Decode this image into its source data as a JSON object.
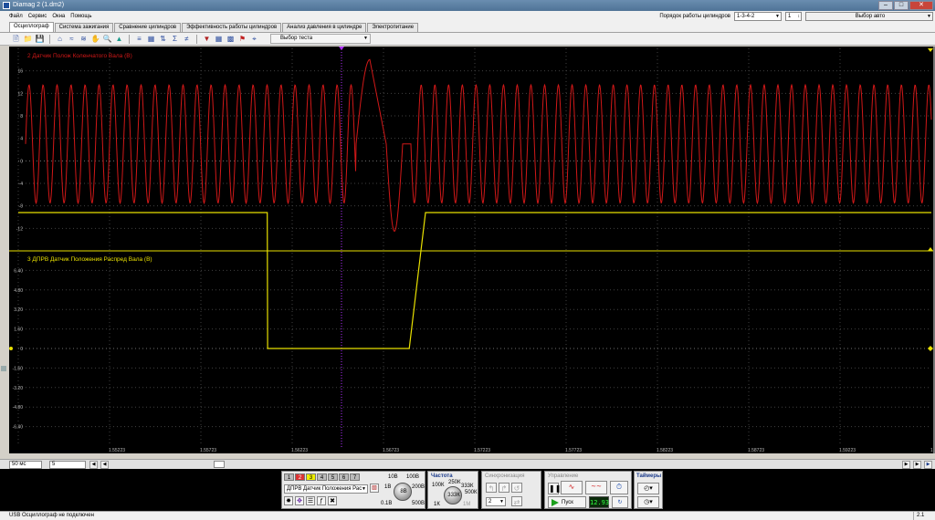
{
  "window": {
    "title": "Diamag 2 (1.dm2)"
  },
  "menu": [
    "Файл",
    "Сервис",
    "Окна",
    "Помощь"
  ],
  "firing_order": {
    "label": "Порядок работы цилиндров",
    "value": "1-3-4-2",
    "cylinder": "1",
    "auto_select": "Выбор авто"
  },
  "tabs": [
    "Осциллограф",
    "Система зажигания",
    "Сравнение цилиндров",
    "Эффективность работы цилиндров",
    "Анализ давления в цилиндре",
    "Электропитание"
  ],
  "toolbar": {
    "test_select": "Выбор теста"
  },
  "plot": {
    "background": "#000000",
    "channel2": {
      "label": "2 Датчик Полож Коленчатого Вала (В)",
      "color": "#d11818",
      "yticks": [
        "16",
        "12",
        "8",
        "4",
        "0",
        "-4",
        "-8",
        "-12"
      ]
    },
    "channel3": {
      "label": "3 ДПРВ Датчик Положения Распред Вала (В)",
      "color": "#e8e000",
      "yticks": [
        "6.40",
        "4.80",
        "3.20",
        "1.60",
        "0",
        "-1.60",
        "-3.20",
        "-4.80",
        "-6.40"
      ]
    },
    "xticks": [
      "1.55223",
      "1.55723",
      "1.56223",
      "1.56723",
      "1.57223",
      "1.57723",
      "1.58223",
      "1.58723",
      "1.59223",
      "1.59723"
    ]
  },
  "chart_data": {
    "type": "line",
    "x": {
      "tick_labels": [
        "1.55223",
        "1.55723",
        "1.56223",
        "1.56723",
        "1.57223",
        "1.57723",
        "1.58223",
        "1.58723",
        "1.59223",
        "1.59723"
      ],
      "range": [
        1.55223,
        1.59723
      ]
    },
    "series": [
      {
        "name": "2 Датчик Полож Коленчатого Вала (В)",
        "color": "#d11818",
        "ylim": [
          -16,
          20
        ],
        "description_values": {
          "amplitude_pos": 13.5,
          "amplitude_neg": -7.5,
          "cycles_visible": 60,
          "missing_tooth_spike_max": 18,
          "missing_tooth_spike_min": -12.5
        }
      },
      {
        "name": "3 ДПРВ Датчик Положения Распред Вала (В)",
        "color": "#e8e000",
        "ylim": [
          -8,
          8
        ],
        "points": [
          [
            1.55223,
            11.5
          ],
          [
            1.5645,
            11.6
          ],
          [
            1.56452,
            0
          ],
          [
            1.5715,
            0
          ],
          [
            1.5723,
            11.6
          ],
          [
            1.59723,
            11.5
          ]
        ]
      }
    ],
    "grid": true
  },
  "scroll": {
    "timebase": "50 мс",
    "channels": "5"
  },
  "controls": {
    "channel_tabs": [
      "1",
      "2",
      "3",
      "4",
      "5",
      "6",
      "7"
    ],
    "channel_name": "ДПРВ Датчик Положения Рас",
    "voltage_knob": {
      "value": "8В",
      "labels": [
        "10В",
        "100В",
        "1В",
        "200В",
        "0.1В",
        "500В"
      ]
    },
    "frequency": {
      "title": "Частота",
      "value": "333К",
      "labels": [
        "100К",
        "250К",
        "333К",
        "500К",
        "1К",
        "1М"
      ]
    },
    "sync": {
      "title": "Синхронизация",
      "value": "2"
    },
    "control": {
      "title": "Управление",
      "start": "Пуск",
      "time": "12.93"
    },
    "timers": {
      "title": "Таймеры"
    }
  },
  "status": {
    "text": "USB Осциллограф не подключен",
    "right": "2.1"
  }
}
